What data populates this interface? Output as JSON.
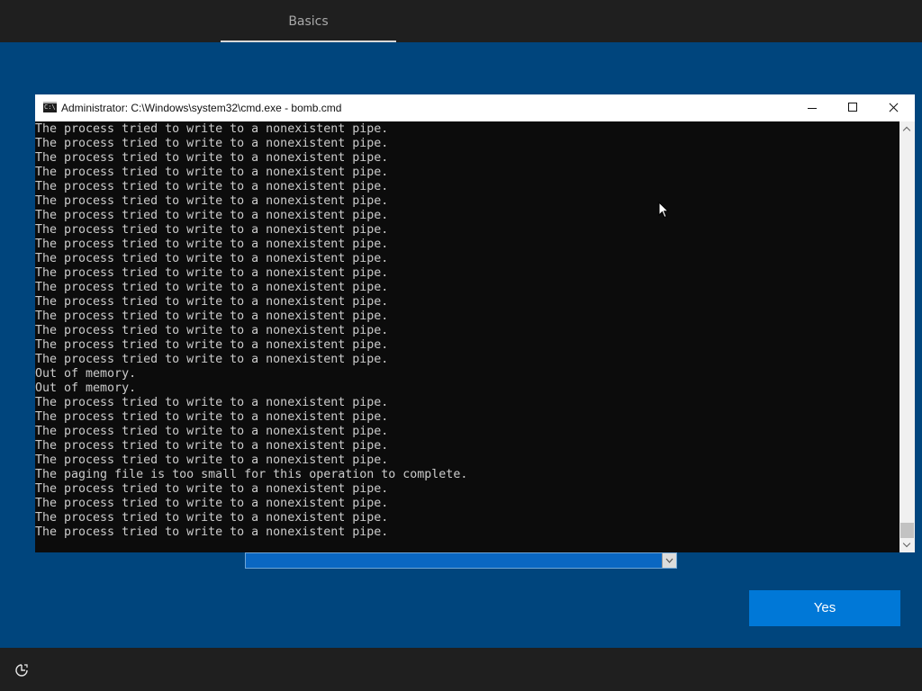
{
  "setup": {
    "tab_label": "Basics",
    "yes_label": "Yes"
  },
  "cmd_window": {
    "title": "Administrator: C:\\Windows\\system32\\cmd.exe - bomb.cmd",
    "icon_text": "C:\\",
    "lines": [
      "The process tried to write to a nonexistent pipe.",
      "The process tried to write to a nonexistent pipe.",
      "The process tried to write to a nonexistent pipe.",
      "The process tried to write to a nonexistent pipe.",
      "The process tried to write to a nonexistent pipe.",
      "The process tried to write to a nonexistent pipe.",
      "The process tried to write to a nonexistent pipe.",
      "The process tried to write to a nonexistent pipe.",
      "The process tried to write to a nonexistent pipe.",
      "The process tried to write to a nonexistent pipe.",
      "The process tried to write to a nonexistent pipe.",
      "The process tried to write to a nonexistent pipe.",
      "The process tried to write to a nonexistent pipe.",
      "The process tried to write to a nonexistent pipe.",
      "The process tried to write to a nonexistent pipe.",
      "The process tried to write to a nonexistent pipe.",
      "The process tried to write to a nonexistent pipe.",
      "Out of memory.",
      "Out of memory.",
      "The process tried to write to a nonexistent pipe.",
      "The process tried to write to a nonexistent pipe.",
      "The process tried to write to a nonexistent pipe.",
      "The process tried to write to a nonexistent pipe.",
      "The process tried to write to a nonexistent pipe.",
      "The paging file is too small for this operation to complete.",
      "The process tried to write to a nonexistent pipe.",
      "The process tried to write to a nonexistent pipe.",
      "The process tried to write to a nonexistent pipe.",
      "The process tried to write to a nonexistent pipe."
    ]
  },
  "icons": {
    "window_controls": [
      "minimize-icon",
      "maximize-icon",
      "close-icon"
    ],
    "bottom": "accessibility-icon",
    "pointer": "mouse-pointer-icon"
  },
  "colors": {
    "background": "#00457d",
    "accent": "#0078d7",
    "console_bg": "#0c0c0c",
    "console_text": "#cccccc"
  }
}
